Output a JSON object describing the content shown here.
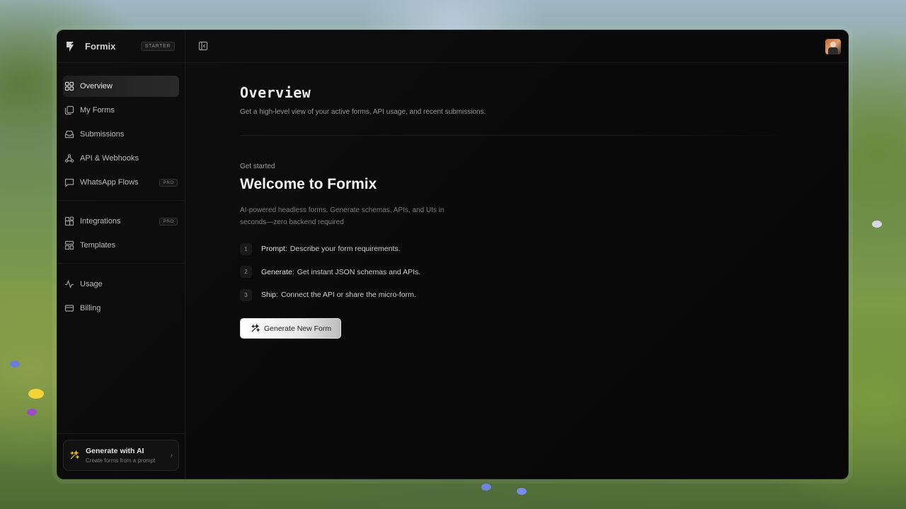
{
  "brand": {
    "name": "Formix",
    "plan": "STARTER"
  },
  "sidebar": {
    "items": [
      {
        "label": "Overview",
        "icon": "grid-icon",
        "active": true
      },
      {
        "label": "My Forms",
        "icon": "copy-icon"
      },
      {
        "label": "Submissions",
        "icon": "inbox-icon"
      },
      {
        "label": "API & Webhooks",
        "icon": "webhook-icon"
      },
      {
        "label": "WhatsApp Flows",
        "icon": "chat-icon",
        "badge": "PRO"
      },
      {
        "label": "Integrations",
        "icon": "blocks-icon",
        "badge": "PRO"
      },
      {
        "label": "Templates",
        "icon": "layout-icon"
      },
      {
        "label": "Usage",
        "icon": "activity-icon"
      },
      {
        "label": "Billing",
        "icon": "card-icon"
      }
    ],
    "footer": {
      "title": "Generate with AI",
      "subtitle": "Create forms from a prompt"
    }
  },
  "main": {
    "title": "Overview",
    "subtitle": "Get a high-level view of your active forms, API usage, and recent submissions.",
    "kicker": "Get started",
    "welcome": "Welcome to Formix",
    "tagline": "AI-powered headless forms. Generate schemas, APIs, and UIs in seconds—zero backend required",
    "steps": [
      {
        "num": "1",
        "key": "Prompt:",
        "desc": "Describe your form requirements."
      },
      {
        "num": "2",
        "key": "Generate:",
        "desc": "Get instant JSON schemas and APIs."
      },
      {
        "num": "3",
        "key": "Ship:",
        "desc": "Connect the API or share the micro-form."
      }
    ],
    "cta": "Generate New Form"
  },
  "colors": {
    "background": "#0a0a0a",
    "accent": "#f5c518",
    "cta_bg": "#ffffff"
  }
}
